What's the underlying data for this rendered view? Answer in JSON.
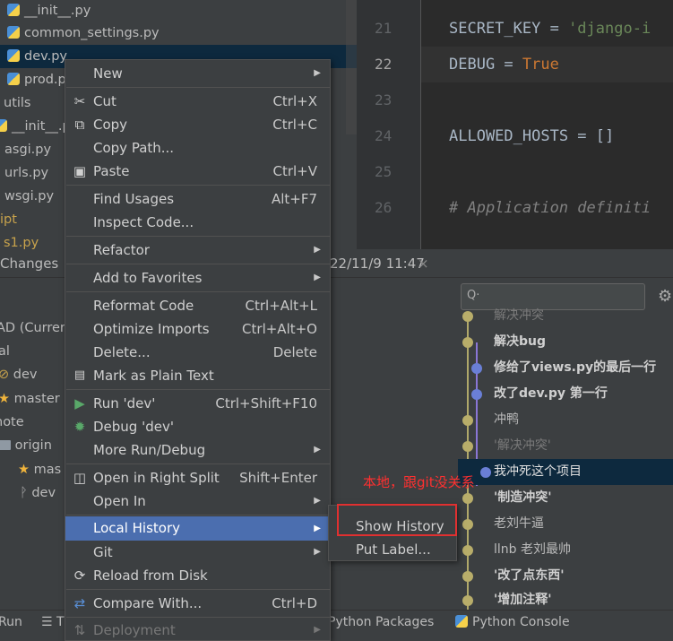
{
  "tree": {
    "items": [
      {
        "label": "__init__.py",
        "icon": "python-file-icon"
      },
      {
        "label": "common_settings.py",
        "icon": "python-file-icon"
      },
      {
        "label": "dev.py",
        "icon": "python-file-icon"
      },
      {
        "label": "prod.p",
        "icon": "python-file-icon"
      },
      {
        "label": "utils",
        "icon": ""
      },
      {
        "label": "__init__.py",
        "icon": "python-file-icon"
      },
      {
        "label": "asgi.py",
        "icon": "python-file-icon"
      },
      {
        "label": "urls.py",
        "icon": "python-file-icon"
      },
      {
        "label": "wsgi.py",
        "icon": "python-file-icon"
      },
      {
        "label": "ipt",
        "icon": ""
      },
      {
        "label": "s1.py",
        "icon": ""
      }
    ]
  },
  "editor": {
    "lines": [
      {
        "num": "21",
        "code_prefix": "SECRET_KEY = ",
        "code_string": "'django-i"
      },
      {
        "num": "22",
        "code_prefix": "DEBUG = ",
        "code_keyword": "True"
      },
      {
        "num": "23",
        "code_prefix": ""
      },
      {
        "num": "24",
        "code_prefix": "ALLOWED_HOSTS = []"
      },
      {
        "num": "25",
        "code_prefix": ""
      },
      {
        "num": "26",
        "code_comment": "# Application definiti"
      }
    ]
  },
  "changes": {
    "tab_label": "Changes",
    "timestamp": "22/11/9 11:47",
    "close_glyph": "×",
    "search_placeholder": "Q·",
    "branches": [
      {
        "label": "AD (Curren",
        "icon": ""
      },
      {
        "label": "al",
        "icon": ""
      },
      {
        "label": "dev",
        "icon": "tag-icon"
      },
      {
        "label": "master",
        "icon": "star-icon"
      },
      {
        "label": "note",
        "icon": ""
      },
      {
        "label": "origin",
        "icon": "folder-icon"
      },
      {
        "label": "mas",
        "icon": "star-icon"
      },
      {
        "label": "dev",
        "icon": "branch-icon"
      }
    ],
    "commits": [
      {
        "text": "解决冲突",
        "style": "dim"
      },
      {
        "text": "解决bug",
        "style": "bold"
      },
      {
        "text": "修给了views.py的最后一行",
        "style": "bold"
      },
      {
        "text": "改了dev.py 第一行",
        "style": "bold"
      },
      {
        "text": "冲鸭",
        "style": "normal"
      },
      {
        "text": "'解决冲突'",
        "style": "dim"
      },
      {
        "text": "我冲死这个项目",
        "style": "normal"
      },
      {
        "text": "'制造冲突'",
        "style": "bold"
      },
      {
        "text": "老刘牛逼",
        "style": "normal"
      },
      {
        "text": "llnb 老刘最帅",
        "style": "normal"
      },
      {
        "text": "'改了点东西'",
        "style": "bold"
      },
      {
        "text": "'增加注释'",
        "style": "bold"
      }
    ]
  },
  "bottombar": {
    "run": "Run",
    "todo": "T",
    "python_packages": "Python Packages",
    "python_console": "Python Console"
  },
  "menu": {
    "items": [
      {
        "label": "New",
        "shortcut": "",
        "submenu": true,
        "icon": ""
      },
      {
        "label": "Cut",
        "shortcut": "Ctrl+X",
        "submenu": false,
        "icon": "scissors-icon"
      },
      {
        "label": "Copy",
        "shortcut": "Ctrl+C",
        "submenu": false,
        "icon": "copy-icon"
      },
      {
        "label": "Copy Path...",
        "shortcut": "",
        "submenu": false,
        "icon": ""
      },
      {
        "label": "Paste",
        "shortcut": "Ctrl+V",
        "submenu": false,
        "icon": "paste-icon"
      },
      {
        "label": "Find Usages",
        "shortcut": "Alt+F7",
        "submenu": false,
        "icon": ""
      },
      {
        "label": "Inspect Code...",
        "shortcut": "",
        "submenu": false,
        "icon": ""
      },
      {
        "label": "Refactor",
        "shortcut": "",
        "submenu": true,
        "icon": ""
      },
      {
        "label": "Add to Favorites",
        "shortcut": "",
        "submenu": true,
        "icon": ""
      },
      {
        "label": "Reformat Code",
        "shortcut": "Ctrl+Alt+L",
        "submenu": false,
        "icon": ""
      },
      {
        "label": "Optimize Imports",
        "shortcut": "Ctrl+Alt+O",
        "submenu": false,
        "icon": ""
      },
      {
        "label": "Delete...",
        "shortcut": "Delete",
        "submenu": false,
        "icon": ""
      },
      {
        "label": "Mark as Plain Text",
        "shortcut": "",
        "submenu": false,
        "icon": "plain-text-icon"
      },
      {
        "label": "Run 'dev'",
        "shortcut": "Ctrl+Shift+F10",
        "submenu": false,
        "icon": "run-icon"
      },
      {
        "label": "Debug 'dev'",
        "shortcut": "",
        "submenu": false,
        "icon": "debug-icon"
      },
      {
        "label": "More Run/Debug",
        "shortcut": "",
        "submenu": true,
        "icon": ""
      },
      {
        "label": "Open in Right Split",
        "shortcut": "Shift+Enter",
        "submenu": false,
        "icon": "split-icon"
      },
      {
        "label": "Open In",
        "shortcut": "",
        "submenu": true,
        "icon": ""
      },
      {
        "label": "Local History",
        "shortcut": "",
        "submenu": true,
        "icon": ""
      },
      {
        "label": "Git",
        "shortcut": "",
        "submenu": true,
        "icon": ""
      },
      {
        "label": "Reload from Disk",
        "shortcut": "",
        "submenu": false,
        "icon": "reload-icon"
      },
      {
        "label": "Compare With...",
        "shortcut": "Ctrl+D",
        "submenu": false,
        "icon": "compare-icon"
      },
      {
        "label": "Deployment",
        "shortcut": "",
        "submenu": true,
        "icon": "deployment-icon"
      }
    ]
  },
  "submenu": {
    "items": [
      {
        "label": "Show History"
      },
      {
        "label": "Put Label..."
      }
    ]
  },
  "annotation": "本地，跟git没关系",
  "colors": {
    "accent": "#4b6eaf",
    "annotation_red": "#e03030",
    "selection": "#0d293e"
  }
}
